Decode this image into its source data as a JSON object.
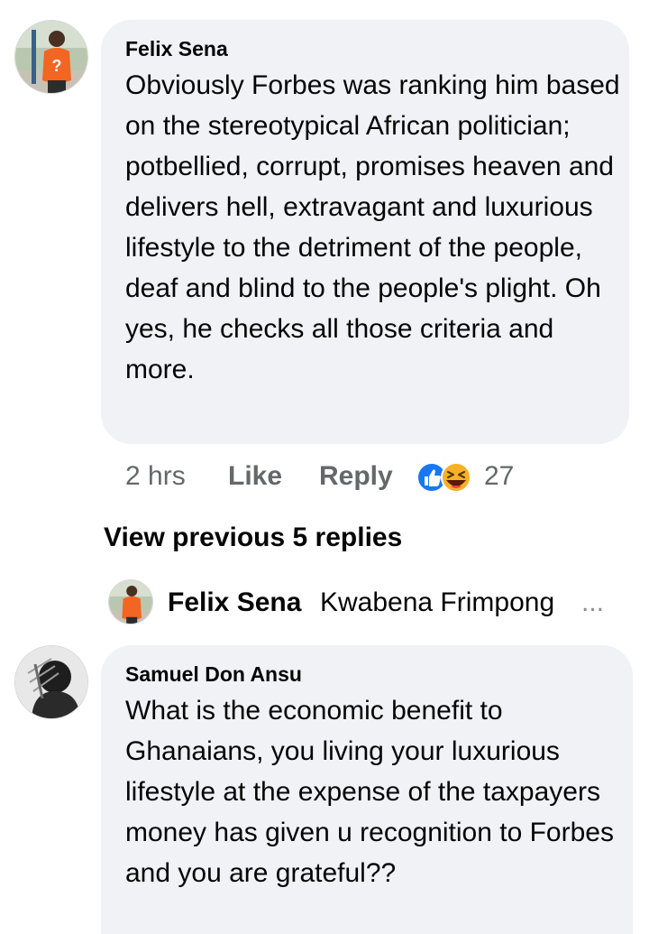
{
  "comments": [
    {
      "author": "Felix Sena",
      "text": "Obviously Forbes was ranking him based on the stereotypical African politician; potbellied, corrupt, promises heaven and delivers hell, extravagant and luxurious lifestyle to the detriment of the people, deaf and blind to the people's plight. Oh yes, he checks all those criteria and more.",
      "time": "2 hrs",
      "like_label": "Like",
      "reply_label": "Reply",
      "reaction_icons": [
        "like-reaction-icon",
        "haha-reaction-icon"
      ],
      "reaction_count": "27"
    },
    {
      "author": "Samuel Don Ansu",
      "text": "What is the economic benefit to Ghanaians, you living your luxurious lifestyle at the expense of the taxpayers money has given  u recognition to Forbes and you are grateful??"
    }
  ],
  "view_previous_label": "View previous 5 replies",
  "collapsed_reply": {
    "author": "Felix Sena",
    "snippet": "Kwabena Frimpong",
    "ellipsis": "..."
  },
  "colors": {
    "bubble": "#f0f2f5",
    "meta_text": "#65676b",
    "like_blue": "#1877f2",
    "haha_yellow": "#f7b125",
    "jersey_orange": "#f26522"
  }
}
